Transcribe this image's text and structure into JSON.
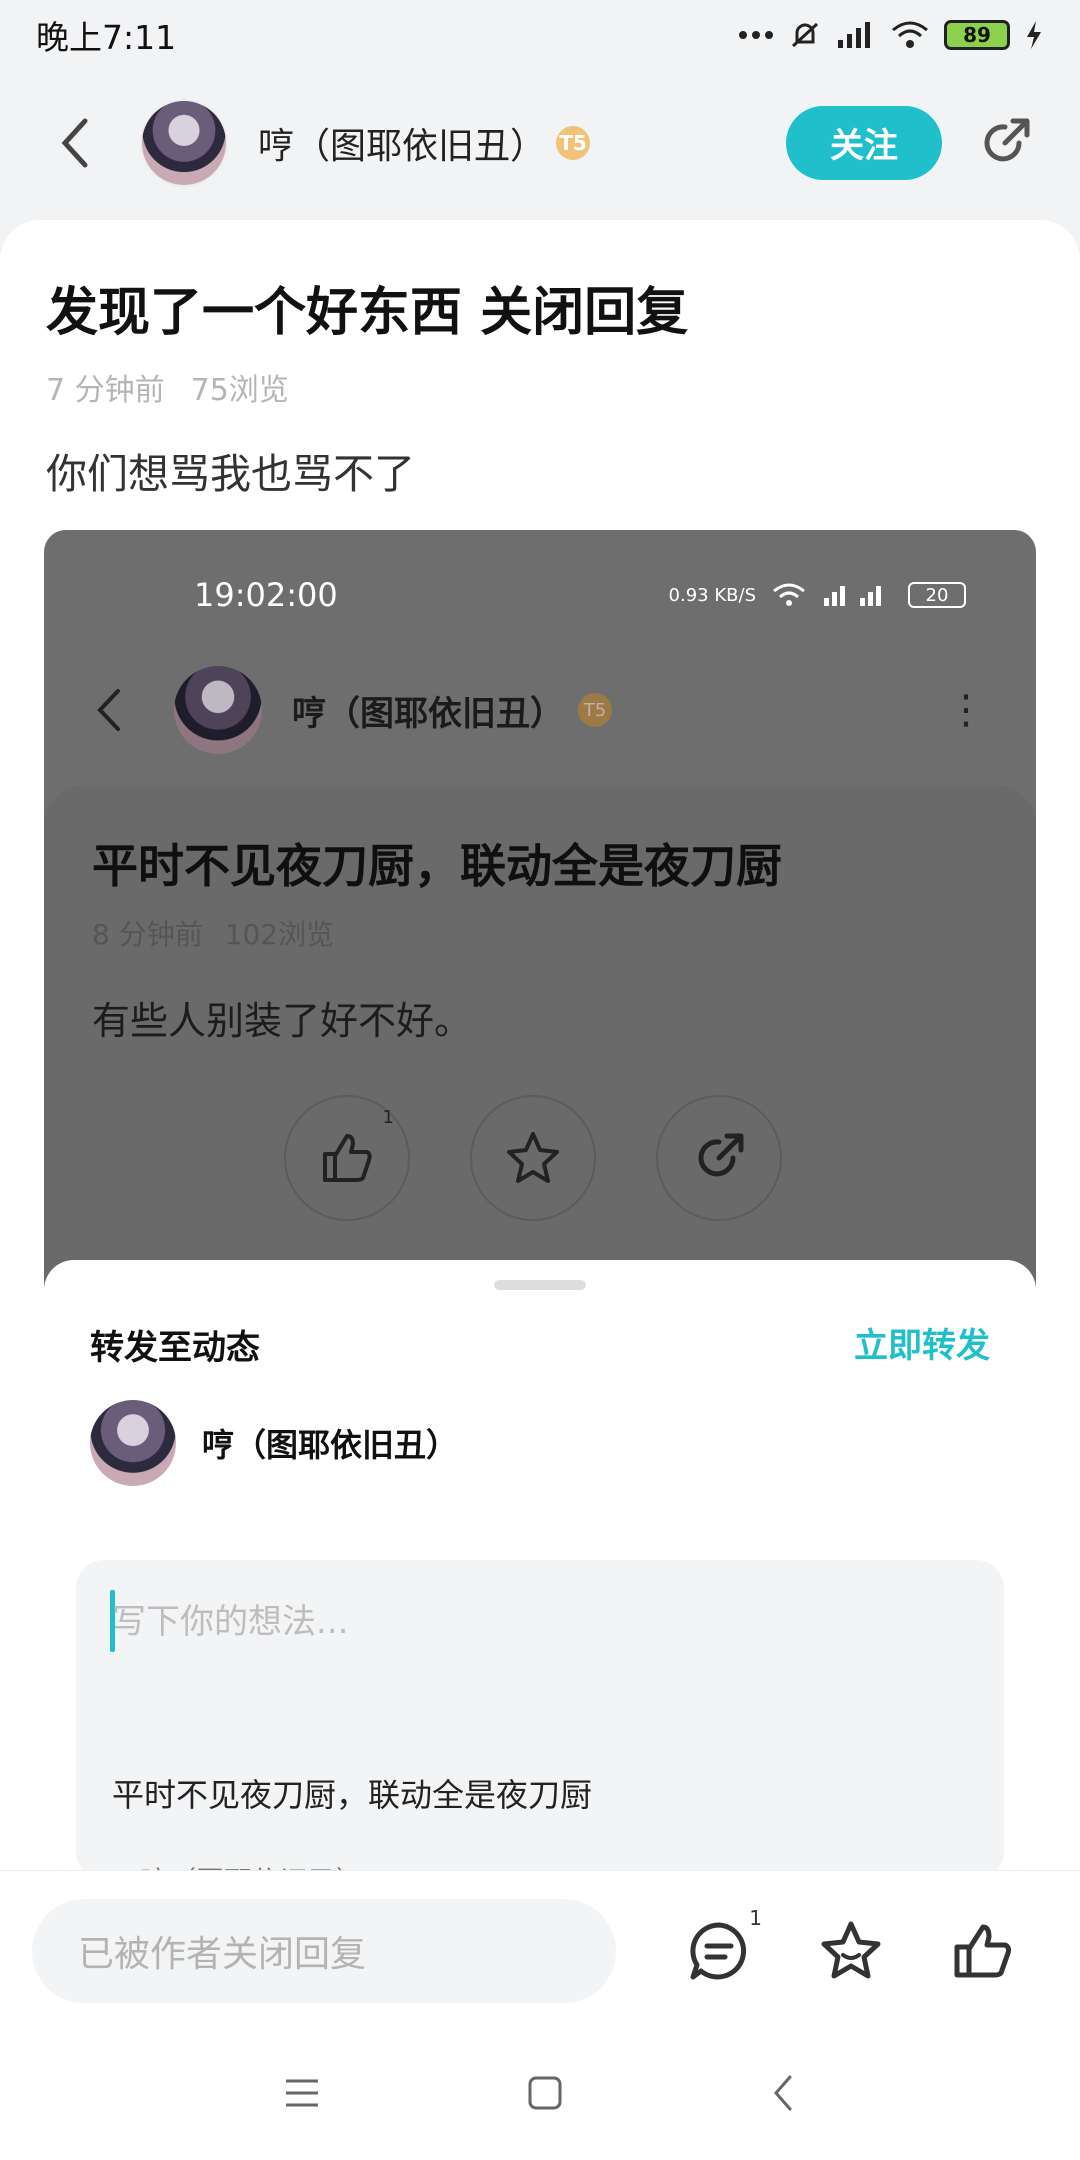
{
  "status_bar": {
    "time": "晚上7:11",
    "battery": "89"
  },
  "header": {
    "author_name": "哼（图耶依旧丑）",
    "level_badge": "T5",
    "follow_label": "关注"
  },
  "post": {
    "title": "发现了一个好东西 关闭回复",
    "time_ago": "7 分钟前",
    "views": "75浏览",
    "body": "你们想骂我也骂不了"
  },
  "embedded": {
    "status_time": "19:02:00",
    "net_speed": "0.93 KB/S",
    "battery": "20",
    "author_name": "哼（图耶依旧丑）",
    "level_badge": "T5",
    "title": "平时不见夜刀厨，联动全是夜刀厨",
    "time_ago": "8 分钟前",
    "views": "102浏览",
    "body": "有些人别装了好不好。",
    "like_count": "1",
    "sheet": {
      "title": "转发至动态",
      "send_label": "立即转发",
      "user_name": "哼（图耶依旧丑）",
      "placeholder": "写下你的想法...",
      "quote_title": "平时不见夜刀厨，联动全是夜刀厨",
      "quote_user": "@哼（图耶依旧丑）"
    }
  },
  "bottom_bar": {
    "reply_placeholder": "已被作者关闭回复",
    "comment_count": "1"
  },
  "colors": {
    "accent": "#1fbfcc",
    "background": "#f2f3f5"
  }
}
